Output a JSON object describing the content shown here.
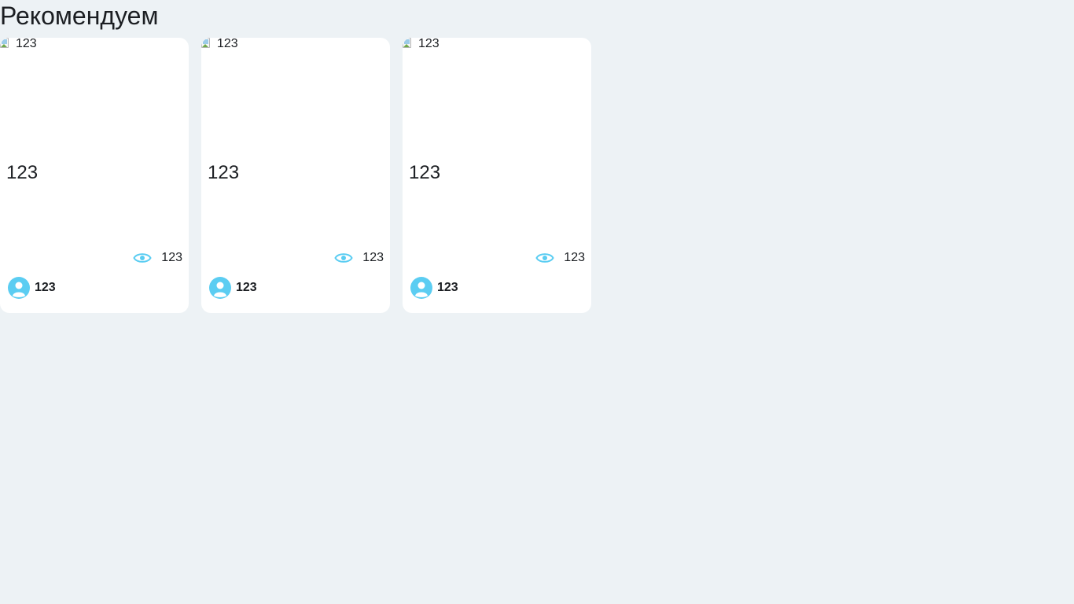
{
  "section": {
    "title": "Рекомендуем"
  },
  "colors": {
    "background": "#edf2f5",
    "card": "#ffffff",
    "accent": "#5bcdf2",
    "text": "#1b1e22"
  },
  "cards": [
    {
      "image_alt": "123",
      "title": "123",
      "views": "123",
      "author": "123",
      "icons": {
        "views": "eye-icon",
        "author": "user-avatar-icon"
      }
    },
    {
      "image_alt": "123",
      "title": "123",
      "views": "123",
      "author": "123",
      "icons": {
        "views": "eye-icon",
        "author": "user-avatar-icon"
      }
    },
    {
      "image_alt": "123",
      "title": "123",
      "views": "123",
      "author": "123",
      "icons": {
        "views": "eye-icon",
        "author": "user-avatar-icon"
      }
    }
  ]
}
